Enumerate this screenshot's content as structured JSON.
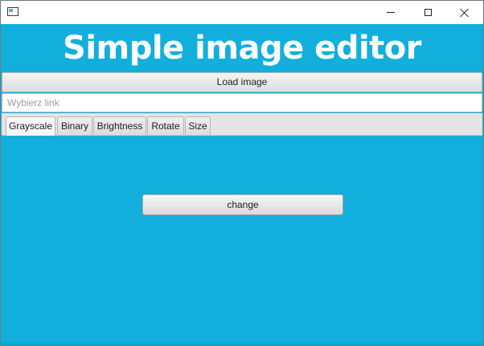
{
  "window": {
    "title": "",
    "controls": {
      "minimize": "minimize-icon",
      "maximize": "maximize-icon",
      "close": "close-icon"
    }
  },
  "colors": {
    "background": "#12afdd",
    "title_text": "#ffffff"
  },
  "header": {
    "title": "Simple image editor"
  },
  "load_button": {
    "label": "Load image"
  },
  "link_input": {
    "value": "",
    "placeholder": "Wybierz link"
  },
  "tabs": [
    {
      "label": "Grayscale",
      "selected": true
    },
    {
      "label": "Binary",
      "selected": false
    },
    {
      "label": "Brightness",
      "selected": false
    },
    {
      "label": "Rotate",
      "selected": false
    },
    {
      "label": "Size",
      "selected": false
    }
  ],
  "content": {
    "change_label": "change"
  }
}
